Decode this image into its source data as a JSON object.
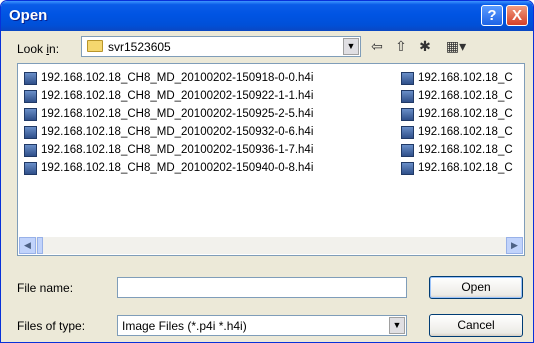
{
  "window": {
    "title": "Open",
    "help_glyph": "?",
    "close_glyph": "X"
  },
  "look_in": {
    "label_prefix": "Look ",
    "label_key": "i",
    "label_suffix": "n:",
    "folder": "svr1523605"
  },
  "toolbar": {
    "back_glyph": "⇦",
    "up_glyph": "⇧",
    "new_folder_glyph": "✱",
    "view_glyph": "▦▾"
  },
  "files": {
    "col1": [
      "192.168.102.18_CH8_MD_20100202-150918-0-0.h4i",
      "192.168.102.18_CH8_MD_20100202-150922-1-1.h4i",
      "192.168.102.18_CH8_MD_20100202-150925-2-5.h4i",
      "192.168.102.18_CH8_MD_20100202-150932-0-6.h4i",
      "192.168.102.18_CH8_MD_20100202-150936-1-7.h4i",
      "192.168.102.18_CH8_MD_20100202-150940-0-8.h4i"
    ],
    "col2": [
      "192.168.102.18_C",
      "192.168.102.18_C",
      "192.168.102.18_C",
      "192.168.102.18_C",
      "192.168.102.18_C",
      "192.168.102.18_C"
    ]
  },
  "scrollbar": {
    "left_glyph": "◀",
    "right_glyph": "▶"
  },
  "file_name": {
    "label": "File name:",
    "value": ""
  },
  "file_type": {
    "label": "Files of type:",
    "value": "Image Files (*.p4i *.h4i)"
  },
  "buttons": {
    "open": "Open",
    "cancel": "Cancel"
  },
  "combo_arrow": "▼"
}
